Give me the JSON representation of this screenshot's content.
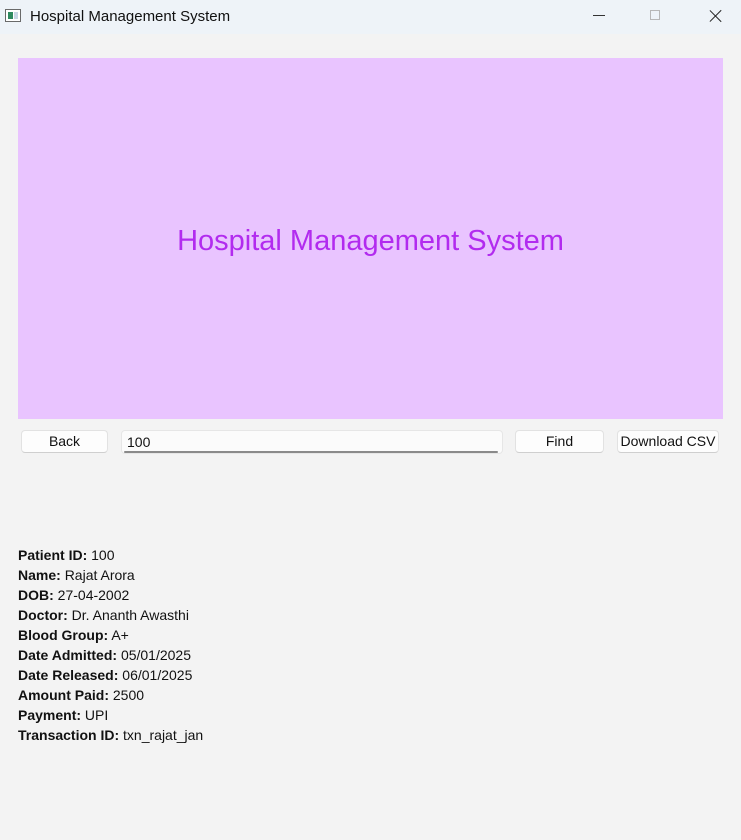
{
  "window": {
    "title": "Hospital Management System",
    "icon": "app-window-icon",
    "controls": [
      "minimize-icon",
      "maximize-icon",
      "close-icon"
    ]
  },
  "banner": {
    "title": "Hospital Management System",
    "background": "#e9c4ff",
    "text_color": "#b22bef"
  },
  "toolbar": {
    "back_label": "Back",
    "search_value": "100",
    "find_label": "Find",
    "download_label": "Download CSV"
  },
  "patient": {
    "rows": [
      {
        "label": "Patient ID:",
        "value": "100"
      },
      {
        "label": "Name:",
        "value": "Rajat Arora"
      },
      {
        "label": "DOB:",
        "value": "27-04-2002"
      },
      {
        "label": "Doctor:",
        "value": "Dr. Ananth Awasthi"
      },
      {
        "label": "Blood Group:",
        "value": "A+"
      },
      {
        "label": "Date Admitted:",
        "value": "05/01/2025"
      },
      {
        "label": "Date Released:",
        "value": "06/01/2025"
      },
      {
        "label": "Amount Paid:",
        "value": "2500"
      },
      {
        "label": "Payment:",
        "value": "UPI"
      },
      {
        "label": "Transaction ID:",
        "value": "txn_rajat_jan"
      }
    ]
  }
}
